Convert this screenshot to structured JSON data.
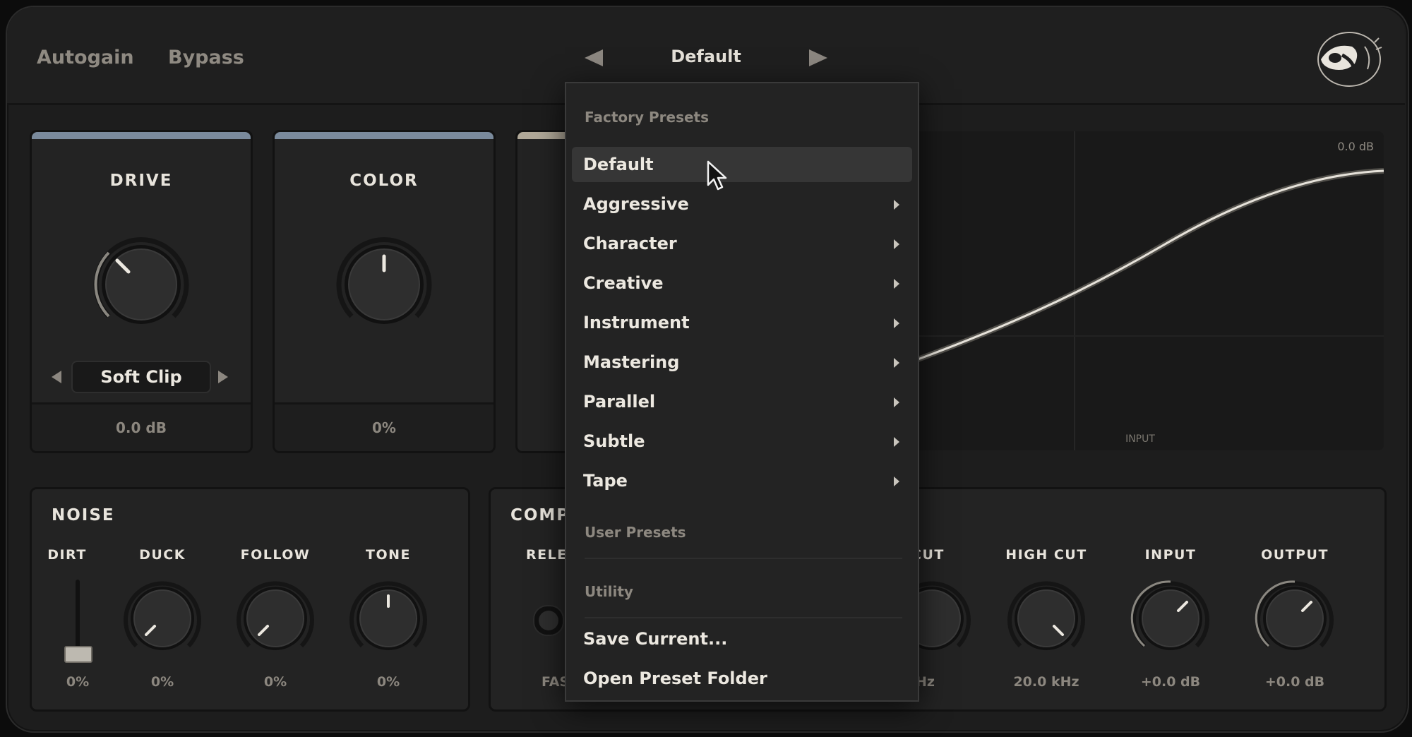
{
  "header": {
    "autogain_label": "Autogain",
    "bypass_label": "Bypass",
    "preset_name": "Default",
    "prev_icon": "left-triangle-icon",
    "next_icon": "right-triangle-icon",
    "logo_icon": "sloth-logo-icon"
  },
  "drive": {
    "title": "DRIVE",
    "mode": "Soft Clip",
    "value": "0.0 dB"
  },
  "color": {
    "title": "COLOR",
    "value": "0%"
  },
  "graph": {
    "db_label": "0.0 dB",
    "input_label": "INPUT"
  },
  "noise": {
    "title": "NOISE",
    "controls": [
      {
        "label": "DIRT",
        "value": "0%"
      },
      {
        "label": "DUCK",
        "value": "0%"
      },
      {
        "label": "FOLLOW",
        "value": "0%"
      },
      {
        "label": "TONE",
        "value": "0%"
      }
    ]
  },
  "comp": {
    "title": "COMP",
    "release_label": "RELE",
    "fast_label": "FAS"
  },
  "filters": {
    "controls": [
      {
        "label": "CUT",
        "value": "Hz"
      },
      {
        "label": "HIGH CUT",
        "value": "20.0 kHz"
      },
      {
        "label": "INPUT",
        "value": "+0.0 dB"
      },
      {
        "label": "OUTPUT",
        "value": "+0.0 dB"
      }
    ]
  },
  "menu": {
    "factory_header": "Factory Presets",
    "items": [
      {
        "label": "Default",
        "submenu": false
      },
      {
        "label": "Aggressive",
        "submenu": true
      },
      {
        "label": "Character",
        "submenu": true
      },
      {
        "label": "Creative",
        "submenu": true
      },
      {
        "label": "Instrument",
        "submenu": true
      },
      {
        "label": "Mastering",
        "submenu": true
      },
      {
        "label": "Parallel",
        "submenu": true
      },
      {
        "label": "Subtle",
        "submenu": true
      },
      {
        "label": "Tape",
        "submenu": true
      }
    ],
    "user_header": "User Presets",
    "utility_header": "Utility",
    "save_label": "Save Current...",
    "open_folder_label": "Open Preset Folder"
  }
}
